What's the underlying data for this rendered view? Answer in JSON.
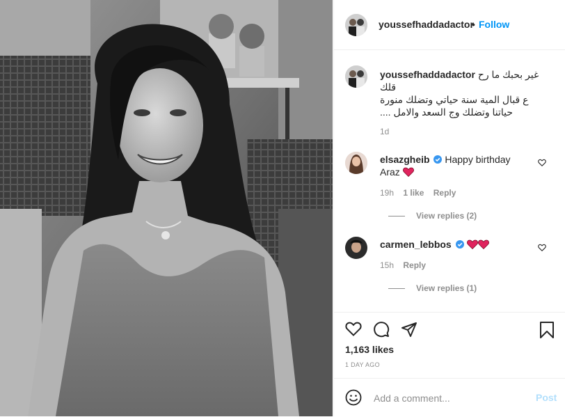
{
  "post": {
    "author": "youssefhaddadactor",
    "follow_dot": "•",
    "follow_label": "Follow",
    "caption_lines": [
      "غير بحبك ما رح",
      "قلك",
      "ع قبال المية سنة حياتي وتضلك منورة",
      "حياتنا وتضلك وج السعد والامل ...."
    ],
    "caption_time": "1d"
  },
  "comments": [
    {
      "username": "elsazgheib",
      "verified": true,
      "text_line1": "Happy birthday",
      "text_line2": "Araz",
      "time": "19h",
      "likes": "1 like",
      "reply_label": "Reply",
      "view_replies": "View replies (2)"
    },
    {
      "username": "carmen_lebbos",
      "verified": true,
      "text": "",
      "time": "15h",
      "reply_label": "Reply",
      "view_replies": "View replies (1)"
    }
  ],
  "actions": {
    "icons": [
      "heart-icon",
      "comment-icon",
      "share-icon",
      "bookmark-icon"
    ],
    "likes": "1,163 likes",
    "date": "1 DAY AGO"
  },
  "add_comment": {
    "placeholder": "Add a comment...",
    "post_label": "Post",
    "emoji_icon": "emoji-icon"
  },
  "colors": {
    "link_blue": "#0095f6",
    "verified_blue": "#3897f0",
    "heart_red": "#e0245e",
    "muted": "#8e8e8e",
    "post_disabled": "#b2dffc"
  }
}
